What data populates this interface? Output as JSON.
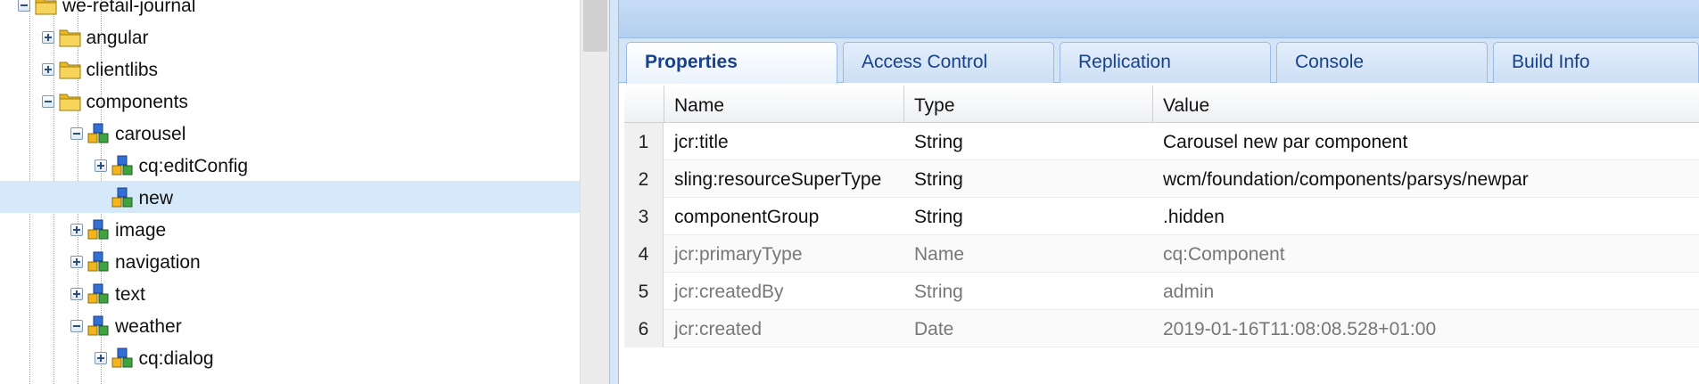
{
  "tree": {
    "items": [
      {
        "label": "we-retail-journal",
        "type": "folder",
        "depth": 0,
        "toggle": "minus"
      },
      {
        "label": "angular",
        "type": "folder",
        "depth": 1,
        "toggle": "plus"
      },
      {
        "label": "clientlibs",
        "type": "folder",
        "depth": 1,
        "toggle": "plus"
      },
      {
        "label": "components",
        "type": "folder",
        "depth": 1,
        "toggle": "minus"
      },
      {
        "label": "carousel",
        "type": "component",
        "depth": 2,
        "toggle": "minus"
      },
      {
        "label": "cq:editConfig",
        "type": "component",
        "depth": 3,
        "toggle": "plus"
      },
      {
        "label": "new",
        "type": "component",
        "depth": 3,
        "toggle": "none",
        "selected": true
      },
      {
        "label": "image",
        "type": "component",
        "depth": 2,
        "toggle": "plus"
      },
      {
        "label": "navigation",
        "type": "component",
        "depth": 2,
        "toggle": "plus"
      },
      {
        "label": "text",
        "type": "component",
        "depth": 2,
        "toggle": "plus"
      },
      {
        "label": "weather",
        "type": "component",
        "depth": 2,
        "toggle": "minus"
      },
      {
        "label": "cq:dialog",
        "type": "component",
        "depth": 3,
        "toggle": "plus"
      }
    ]
  },
  "tabs": [
    {
      "label": "Properties",
      "active": true
    },
    {
      "label": "Access Control",
      "active": false
    },
    {
      "label": "Replication",
      "active": false
    },
    {
      "label": "Console",
      "active": false
    },
    {
      "label": "Build Info",
      "active": false
    }
  ],
  "grid": {
    "columns": {
      "name": "Name",
      "type": "Type",
      "value": "Value"
    },
    "rows": [
      {
        "num": "1",
        "name": "jcr:title",
        "type": "String",
        "value": "Carousel new par component",
        "protected": false
      },
      {
        "num": "2",
        "name": "sling:resourceSuperType",
        "type": "String",
        "value": "wcm/foundation/components/parsys/newpar",
        "protected": false
      },
      {
        "num": "3",
        "name": "componentGroup",
        "type": "String",
        "value": ".hidden",
        "protected": false
      },
      {
        "num": "4",
        "name": "jcr:primaryType",
        "type": "Name",
        "value": "cq:Component",
        "protected": true
      },
      {
        "num": "5",
        "name": "jcr:createdBy",
        "type": "String",
        "value": "admin",
        "protected": true
      },
      {
        "num": "6",
        "name": "jcr:created",
        "type": "Date",
        "value": "2019-01-16T11:08:08.528+01:00",
        "protected": true
      }
    ]
  },
  "colors": {
    "selection": "#d6e9fb",
    "tab_text": "#15428b",
    "header_blue": "#c7dcf6",
    "protected_text": "#777777"
  }
}
